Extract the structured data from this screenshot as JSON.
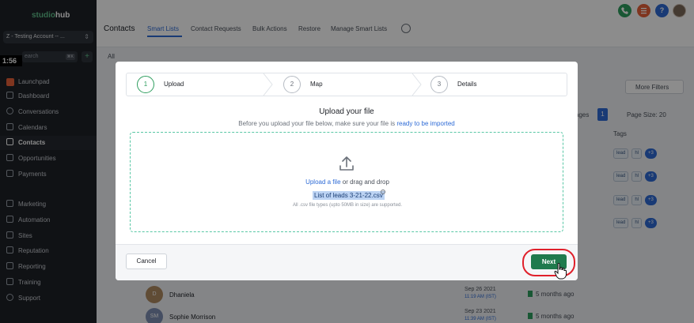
{
  "sidebar": {
    "brand_a": "studio",
    "brand_b": "hub",
    "account": "Z - Testing Account -- ...",
    "search_placeholder": "earch",
    "search_kbd": "⌘K",
    "timer": "1:56",
    "items": [
      {
        "label": "Launchpad"
      },
      {
        "label": "Dashboard"
      },
      {
        "label": "Conversations"
      },
      {
        "label": "Calendars"
      },
      {
        "label": "Contacts"
      },
      {
        "label": "Opportunities"
      },
      {
        "label": "Payments"
      },
      {
        "label": "Marketing"
      },
      {
        "label": "Automation"
      },
      {
        "label": "Sites"
      },
      {
        "label": "Reputation"
      },
      {
        "label": "Reporting"
      },
      {
        "label": "Training"
      },
      {
        "label": "Support"
      }
    ]
  },
  "header": {
    "title": "Contacts",
    "tabs": [
      {
        "label": "Smart Lists"
      },
      {
        "label": "Contact Requests"
      },
      {
        "label": "Bulk Actions"
      },
      {
        "label": "Restore"
      },
      {
        "label": "Manage Smart Lists"
      }
    ],
    "top_buttons": [
      "phone-icon",
      "list-icon",
      "help-icon"
    ],
    "help_label": "?"
  },
  "page": {
    "all_tab": "All",
    "more_filters": "More Filters",
    "pages_text": "ages",
    "page_num": "1",
    "page_size": "Page Size: 20",
    "tags_header": "Tags",
    "tag_labels": [
      "lead",
      "hl",
      "+3"
    ],
    "people": [
      {
        "initial": "D",
        "name": "Dhaniela",
        "date": "Sep 26 2021",
        "time": "11:19 AM (IST)",
        "ago": "5 months ago",
        "color": "#b08a62"
      },
      {
        "initial": "SM",
        "name": "Sophie Morrison",
        "date": "Sep 23 2021",
        "time": "11:39 AM (IST)",
        "ago": "5 months ago",
        "color": "#7f8fb2"
      }
    ]
  },
  "modal": {
    "steps": [
      {
        "num": "1",
        "label": "Upload"
      },
      {
        "num": "2",
        "label": "Map"
      },
      {
        "num": "3",
        "label": "Details"
      }
    ],
    "title": "Upload your file",
    "subtitle_prefix": "Before you upload your file below, make sure your file is ",
    "subtitle_link": "ready to be imported",
    "upload_link": "Upload a file",
    "upload_suffix": " or drag and drop",
    "file_name": "List of leads 3-21-22.csv",
    "file_hint": "All .csv file types (upto 50MB in size) are supported.",
    "cancel_label": "Cancel",
    "next_label": "Next"
  },
  "colors": {
    "accent_green": "#2f9e5f",
    "next_green": "#1f7a4d",
    "link_blue": "#2e6bd6",
    "highlight_red": "#e0202b"
  }
}
